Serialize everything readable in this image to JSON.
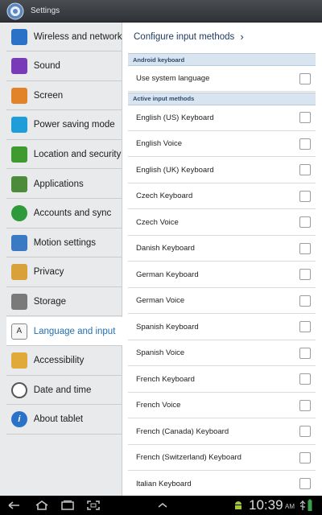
{
  "titlebar": {
    "title": "Settings",
    "icon": "gear-icon"
  },
  "sidebar": {
    "items": [
      {
        "label": "Wireless and networks",
        "icon": "wifi-icon",
        "color": "#2a72c8"
      },
      {
        "label": "Sound",
        "icon": "speaker-icon",
        "color": "#7a3bb8"
      },
      {
        "label": "Screen",
        "icon": "brightness-icon",
        "color": "#e2832a"
      },
      {
        "label": "Power saving mode",
        "icon": "battery-recycle-icon",
        "color": "#1f9dd9"
      },
      {
        "label": "Location and security",
        "icon": "location-grid-icon",
        "color": "#3f9b2f"
      },
      {
        "label": "Applications",
        "icon": "applications-icon",
        "color": "#4c8b3a"
      },
      {
        "label": "Accounts and sync",
        "icon": "sync-icon",
        "color": "#2f9a3a"
      },
      {
        "label": "Motion settings",
        "icon": "motion-tablet-icon",
        "color": "#3a79c4"
      },
      {
        "label": "Privacy",
        "icon": "privacy-icon",
        "color": "#d9a13a"
      },
      {
        "label": "Storage",
        "icon": "storage-icon",
        "color": "#7a7a7a"
      },
      {
        "label": "Language and input",
        "icon": "keyboard-a-icon",
        "color": "#555555"
      },
      {
        "label": "Accessibility",
        "icon": "hand-icon",
        "color": "#e0a93a"
      },
      {
        "label": "Date and time",
        "icon": "clock-icon",
        "color": "#555555"
      },
      {
        "label": "About tablet",
        "icon": "info-icon",
        "color": "#2a72c8"
      }
    ],
    "active_index": 10
  },
  "main": {
    "configure_label": "Configure input methods",
    "sections": [
      {
        "header": "Android keyboard",
        "rows": [
          "Use system language"
        ]
      },
      {
        "header": "Active input methods",
        "rows": [
          "English (US) Keyboard",
          "English Voice",
          "English (UK) Keyboard",
          "Czech Keyboard",
          "Czech Voice",
          "Danish Keyboard",
          "German Keyboard",
          "German Voice",
          "Spanish Keyboard",
          "Spanish Voice",
          "French Keyboard",
          "French Voice",
          "French (Canada) Keyboard",
          "French (Switzerland) Keyboard",
          "Italian Keyboard"
        ]
      }
    ]
  },
  "statusbar": {
    "time": "10:39",
    "ampm": "AM"
  }
}
